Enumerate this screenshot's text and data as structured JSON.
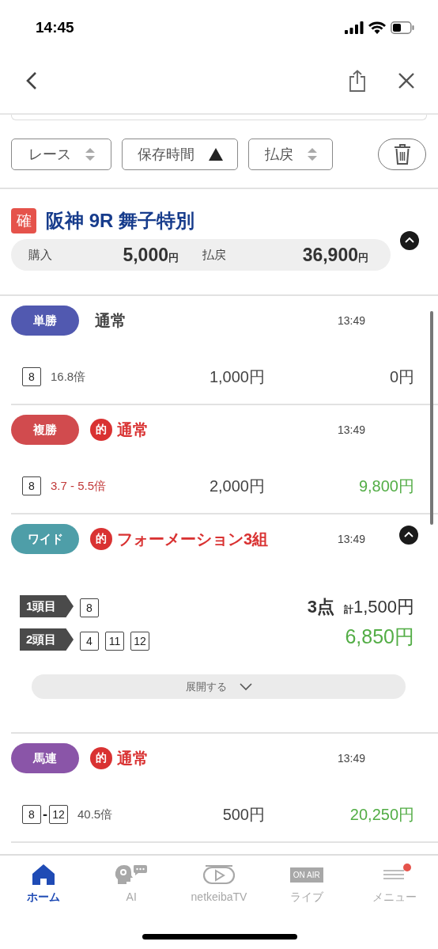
{
  "status_bar": {
    "time": "14:45"
  },
  "sort_buttons": [
    {
      "label": "レース",
      "sorted": false
    },
    {
      "label": "保存時間",
      "sorted": true
    },
    {
      "label": "払戻",
      "sorted": false
    }
  ],
  "race": {
    "status_badge": "確",
    "title": "阪神 9R 舞子特別",
    "expanded": true,
    "purchase_label": "購入",
    "purchase": "5,000",
    "purchase_unit": "円",
    "payout_label": "払戻",
    "payout": "36,900",
    "payout_unit": "円"
  },
  "bets": [
    {
      "kind": "simple",
      "type": "単勝",
      "color": "#5159b0",
      "hit": false,
      "method": "通常",
      "time": "13:49",
      "horses": [
        "8"
      ],
      "odds": "16.8倍",
      "odds_hot": false,
      "stake": "1,000円",
      "payout": "0円"
    },
    {
      "kind": "simple",
      "type": "複勝",
      "color": "#d14b4e",
      "hit": true,
      "hit_mark": "的",
      "method": "通常",
      "time": "13:49",
      "horses": [
        "8"
      ],
      "odds": "3.7 - 5.5倍",
      "odds_hot": true,
      "stake": "2,000円",
      "payout": "9,800円"
    },
    {
      "kind": "formation",
      "type": "ワイド",
      "color": "#4e9ea8",
      "hit": true,
      "hit_mark": "的",
      "method": "フォーメーション3組",
      "time": "13:49",
      "expanded": true,
      "legs": [
        {
          "label": "1頭目",
          "horses": [
            "8"
          ]
        },
        {
          "label": "2頭目",
          "horses": [
            "4",
            "11",
            "12"
          ]
        }
      ],
      "points": "3点",
      "total_label": "計",
      "total": "1,500円",
      "payout": "6,850円",
      "more_button": "展開する"
    },
    {
      "kind": "simple",
      "type": "馬連",
      "color": "#8a55a8",
      "hit": true,
      "hit_mark": "的",
      "method": "通常",
      "time": "13:49",
      "horses": [
        "8",
        "12"
      ],
      "joiner": "-",
      "odds": "40.5倍",
      "odds_hot": false,
      "stake": "500円",
      "payout": "20,250円"
    }
  ],
  "tab_bar": [
    {
      "kind": "home",
      "label": "ホーム",
      "selected": true,
      "notification": false
    },
    {
      "kind": "ai",
      "label": "AI",
      "selected": false,
      "notification": false
    },
    {
      "kind": "tv",
      "label": "netkeibaTV",
      "selected": false,
      "notification": false
    },
    {
      "kind": "live",
      "badge": "ON AIR",
      "label": "ライブ",
      "selected": false,
      "notification": false
    },
    {
      "kind": "menu",
      "label": "メニュー",
      "selected": false,
      "notification": true
    }
  ]
}
